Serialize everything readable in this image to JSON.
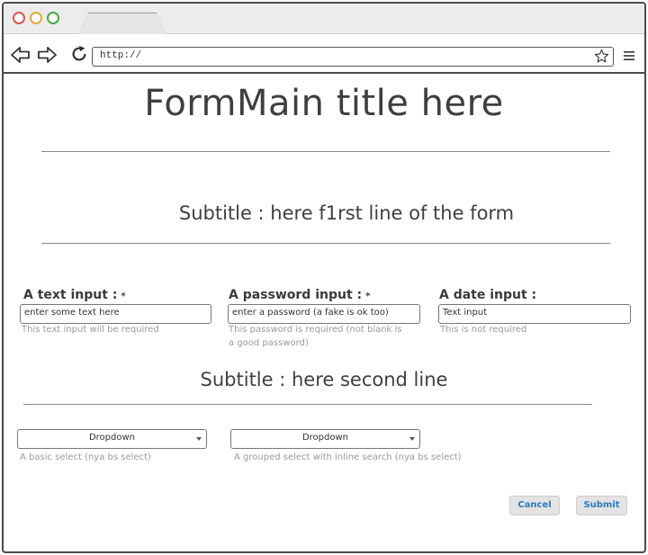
{
  "browser": {
    "url": "http://",
    "icons": [
      "back-icon",
      "forward-icon",
      "reload-icon",
      "star-icon",
      "menu-icon"
    ]
  },
  "page": {
    "title": "FormMain title here",
    "subtitle_1": "Subtitle : here f1rst line of the form",
    "subtitle_2": "Subtitle : here second line"
  },
  "fields": {
    "text": {
      "label": "A text input :",
      "required_marker": "*",
      "value": "enter some text here",
      "help": "This text input will be required"
    },
    "password": {
      "label": "A password input :",
      "required_marker": "*",
      "value": "enter a password (a fake is ok too)",
      "help_line1": "This password is required (not blank is",
      "help_line2": "a good password)"
    },
    "date": {
      "label": "A date input :",
      "value": "Text input",
      "help": "This is not required"
    }
  },
  "selects": {
    "basic": {
      "value": "Dropdown",
      "help": "A basic select (nya bs select)"
    },
    "grouped": {
      "value": "Dropdown",
      "help": "A grouped select with inline search (nya bs select)"
    }
  },
  "actions": {
    "cancel": "Cancel",
    "submit": "Submit"
  },
  "colors": {
    "window_border": "#4a4a4a",
    "close_dot": "#d5574f",
    "minimize_dot": "#e3a93b",
    "maximize_dot": "#4aa844",
    "button_text": "#2a7bbf",
    "button_bg": "#e3e3e3",
    "help_text": "#9a9a9a"
  }
}
